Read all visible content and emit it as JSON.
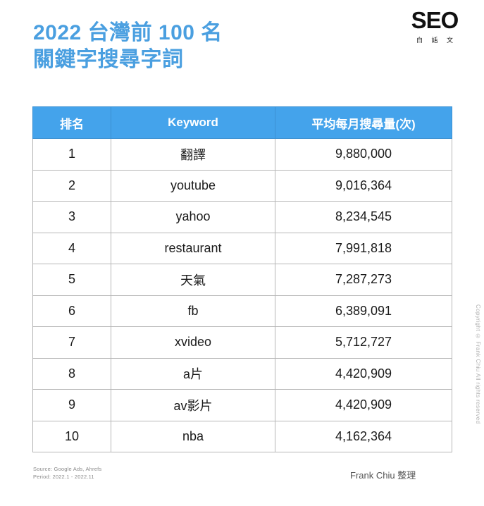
{
  "header": {
    "title_line1": "2022 台灣前 100 名",
    "title_line2": "關鍵字搜尋字詞",
    "title_color": "#4a9fe0",
    "logo_main": "SEO",
    "logo_sub": "白 話 文"
  },
  "table": {
    "header_bg": "#44a3eb",
    "columns": [
      {
        "label": "排名"
      },
      {
        "label": "Keyword"
      },
      {
        "label": "平均每月搜尋量(次)"
      }
    ],
    "rows": [
      {
        "rank": "1",
        "keyword": "翻譯",
        "volume": "9,880,000"
      },
      {
        "rank": "2",
        "keyword": "youtube",
        "volume": "9,016,364"
      },
      {
        "rank": "3",
        "keyword": "yahoo",
        "volume": "8,234,545"
      },
      {
        "rank": "4",
        "keyword": "restaurant",
        "volume": "7,991,818"
      },
      {
        "rank": "5",
        "keyword": "天氣",
        "volume": "7,287,273"
      },
      {
        "rank": "6",
        "keyword": "fb",
        "volume": "6,389,091"
      },
      {
        "rank": "7",
        "keyword": "xvideo",
        "volume": "5,712,727"
      },
      {
        "rank": "8",
        "keyword": "a片",
        "volume": "4,420,909"
      },
      {
        "rank": "9",
        "keyword": "av影片",
        "volume": "4,420,909"
      },
      {
        "rank": "10",
        "keyword": "nba",
        "volume": "4,162,364"
      }
    ]
  },
  "footer": {
    "source": "Source: Google Ads, Ahrefs",
    "period": "Period: 2022.1 - 2022.11",
    "author": "Frank Chiu 整理",
    "copyright": "Copyright © Frank Chiu All rights reserved"
  },
  "chart_data": {
    "type": "table",
    "title": "2022 台灣前 100 名關鍵字搜尋字詞",
    "xlabel": "Keyword",
    "ylabel": "平均每月搜尋量(次)",
    "categories": [
      "翻譯",
      "youtube",
      "yahoo",
      "restaurant",
      "天氣",
      "fb",
      "xvideo",
      "a片",
      "av影片",
      "nba"
    ],
    "values": [
      9880000,
      9016364,
      8234545,
      7991818,
      7287273,
      6389091,
      5712727,
      4420909,
      4420909,
      4162364
    ],
    "ranks": [
      1,
      2,
      3,
      4,
      5,
      6,
      7,
      8,
      9,
      10
    ],
    "source": "Google Ads, Ahrefs",
    "period": "2022.1 - 2022.11",
    "grid": false,
    "legend": "none"
  }
}
